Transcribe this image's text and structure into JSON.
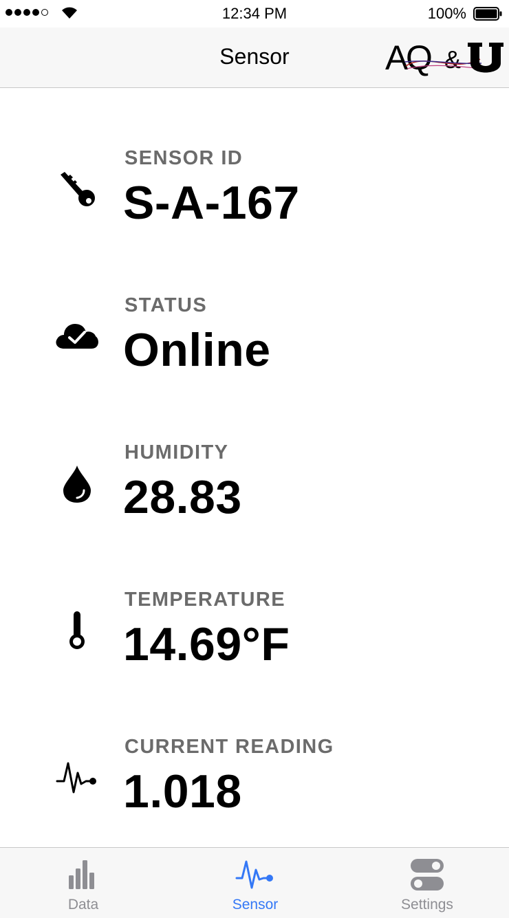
{
  "status_bar": {
    "time": "12:34 PM",
    "battery": "100%"
  },
  "nav": {
    "title": "Sensor",
    "logo_text": "AQ&U"
  },
  "rows": [
    {
      "label": "SENSOR ID",
      "value": "S-A-167",
      "icon": "key-icon"
    },
    {
      "label": "STATUS",
      "value": "Online",
      "icon": "cloud-check-icon"
    },
    {
      "label": "HUMIDITY",
      "value": "28.83",
      "icon": "water-drop-icon"
    },
    {
      "label": "TEMPERATURE",
      "value": "14.69°F",
      "icon": "thermometer-icon"
    },
    {
      "label": "CURRENT READING",
      "value": "1.018",
      "icon": "pulse-icon"
    }
  ],
  "tabs": [
    {
      "label": "Data",
      "icon": "bar-chart-icon",
      "active": false
    },
    {
      "label": "Sensor",
      "icon": "pulse-icon",
      "active": true
    },
    {
      "label": "Settings",
      "icon": "toggles-icon",
      "active": false
    }
  ],
  "colors": {
    "accent": "#3478f6",
    "label_gray": "#6b6b6b",
    "inactive_tab": "#8e8e93",
    "bar_bg": "#f7f7f7"
  }
}
